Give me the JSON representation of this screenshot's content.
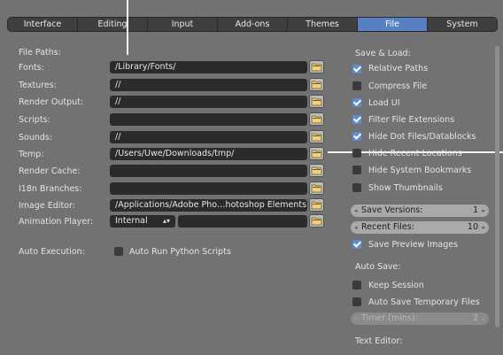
{
  "tabs": [
    {
      "label": "Interface",
      "active": false
    },
    {
      "label": "Editing",
      "active": false
    },
    {
      "label": "Input",
      "active": false
    },
    {
      "label": "Add-ons",
      "active": false
    },
    {
      "label": "Themes",
      "active": false
    },
    {
      "label": "File",
      "active": true
    },
    {
      "label": "System",
      "active": false
    }
  ],
  "file_paths": {
    "heading": "File Paths:",
    "rows": [
      {
        "label": "Fonts:",
        "value": "/Library/Fonts/"
      },
      {
        "label": "Textures:",
        "value": "//"
      },
      {
        "label": "Render Output:",
        "value": "//"
      },
      {
        "label": "Scripts:",
        "value": ""
      },
      {
        "label": "Sounds:",
        "value": "//"
      },
      {
        "label": "Temp:",
        "value": "/Users/Uwe/Downloads/tmp/"
      },
      {
        "label": "Render Cache:",
        "value": ""
      },
      {
        "label": "I18n Branches:",
        "value": ""
      },
      {
        "label": "Image Editor:",
        "value": "/Applications/Adobe Pho…hotoshop Elements.app/"
      }
    ],
    "animation_player": {
      "label": "Animation Player:",
      "value": "Internal",
      "path": ""
    }
  },
  "auto_execution": {
    "label": "Auto Execution:",
    "checkbox": {
      "label": "Auto Run Python Scripts",
      "checked": false
    }
  },
  "save_load": {
    "heading": "Save & Load:",
    "options": [
      {
        "label": "Relative Paths",
        "checked": true
      },
      {
        "label": "Compress File",
        "checked": false
      },
      {
        "label": "Load UI",
        "checked": true
      },
      {
        "label": "Filter File Extensions",
        "checked": true
      },
      {
        "label": "Hide Dot Files/Datablocks",
        "checked": true
      },
      {
        "label": "Hide Recent Locations",
        "checked": false
      },
      {
        "label": "Hide System Bookmarks",
        "checked": false
      },
      {
        "label": "Show Thumbnails",
        "checked": false
      }
    ],
    "save_versions": {
      "label": "Save Versions:",
      "value": "1"
    },
    "recent_files": {
      "label": "Recent Files:",
      "value": "10"
    },
    "save_preview": {
      "label": "Save Preview Images",
      "checked": true
    }
  },
  "auto_save": {
    "heading": "Auto Save:",
    "keep_session": {
      "label": "Keep Session",
      "checked": false
    },
    "temp_files": {
      "label": "Auto Save Temporary Files",
      "checked": false
    },
    "timer": {
      "label": "Timer (mins):",
      "value": "2"
    }
  },
  "text_editor": {
    "heading": "Text Editor:"
  },
  "colors": {
    "accent": "#5680c2",
    "background": "#727272",
    "field": "#2b2b2b"
  }
}
